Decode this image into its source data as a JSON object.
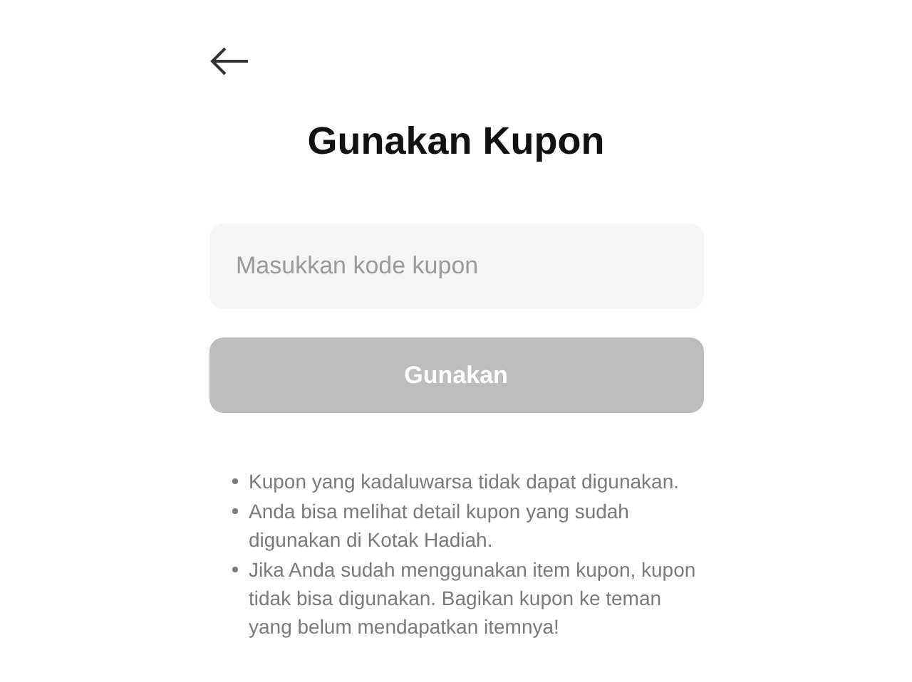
{
  "header": {
    "title": "Gunakan Kupon"
  },
  "coupon_field": {
    "placeholder": "Masukkan kode kupon"
  },
  "submit_button": {
    "label": "Gunakan",
    "disabled": true
  },
  "notes": [
    "Kupon yang kadaluwarsa tidak dapat digunakan.",
    "Anda bisa melihat detail kupon yang sudah digunakan di Kotak Hadiah.",
    "Jika Anda sudah menggunakan item kupon, kupon tidak bisa digunakan. Bagikan kupon ke teman yang belum mendapatkan itemnya!"
  ]
}
